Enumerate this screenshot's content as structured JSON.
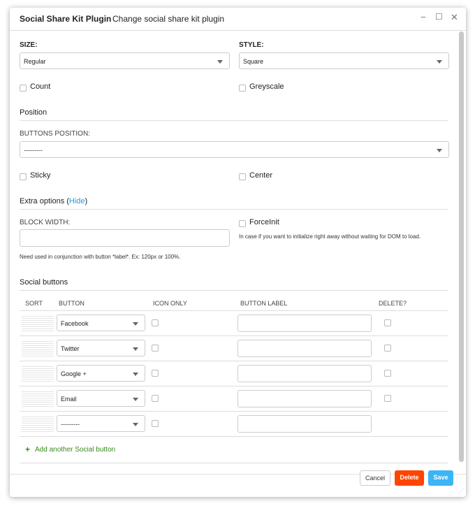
{
  "window": {
    "title": "Social Share Kit Plugin",
    "subtitle": "Change social share kit plugin",
    "minimize": "−",
    "maximize": "☐",
    "close": "✕"
  },
  "size": {
    "label": "SIZE:",
    "value": "Regular"
  },
  "style": {
    "label": "STYLE:",
    "value": "Square"
  },
  "count": {
    "label": "Count",
    "checked": false
  },
  "greyscale": {
    "label": "Greyscale",
    "checked": false
  },
  "position": {
    "heading": "Position",
    "buttons_position_label": "BUTTONS POSITION:",
    "buttons_position_value": "---------",
    "sticky": "Sticky",
    "center": "Center"
  },
  "extra": {
    "heading": "Extra options (",
    "hide_link": "Hide",
    "close_paren": ")",
    "block_width_label": "BLOCK WIDTH:",
    "block_width_value": "",
    "block_width_help": "Need used in conjunction with button *label*. Ex: 120px or 100%.",
    "forceinit": "ForceInit",
    "forceinit_help": "In case if you want to initialize right away without waiting for DOM to load."
  },
  "social": {
    "heading": "Social buttons",
    "columns": [
      "SORT",
      "BUTTON",
      "ICON ONLY",
      "BUTTON LABEL",
      "DELETE?"
    ],
    "rows": [
      {
        "button": "Facebook",
        "label": "",
        "delete": true
      },
      {
        "button": "Twitter",
        "label": "",
        "delete": true
      },
      {
        "button": "Google +",
        "label": "",
        "delete": true
      },
      {
        "button": "Email",
        "label": "",
        "delete": true
      },
      {
        "button": "---------",
        "label": "",
        "delete": false
      }
    ],
    "add": "Add another Social button"
  },
  "footer": {
    "cancel": "Cancel",
    "delete": "Delete",
    "save": "Save"
  },
  "colors": {
    "link": "#1a9be0",
    "add": "#3a8a1e",
    "delete": "#ff4500",
    "save": "#3bb5f5"
  }
}
